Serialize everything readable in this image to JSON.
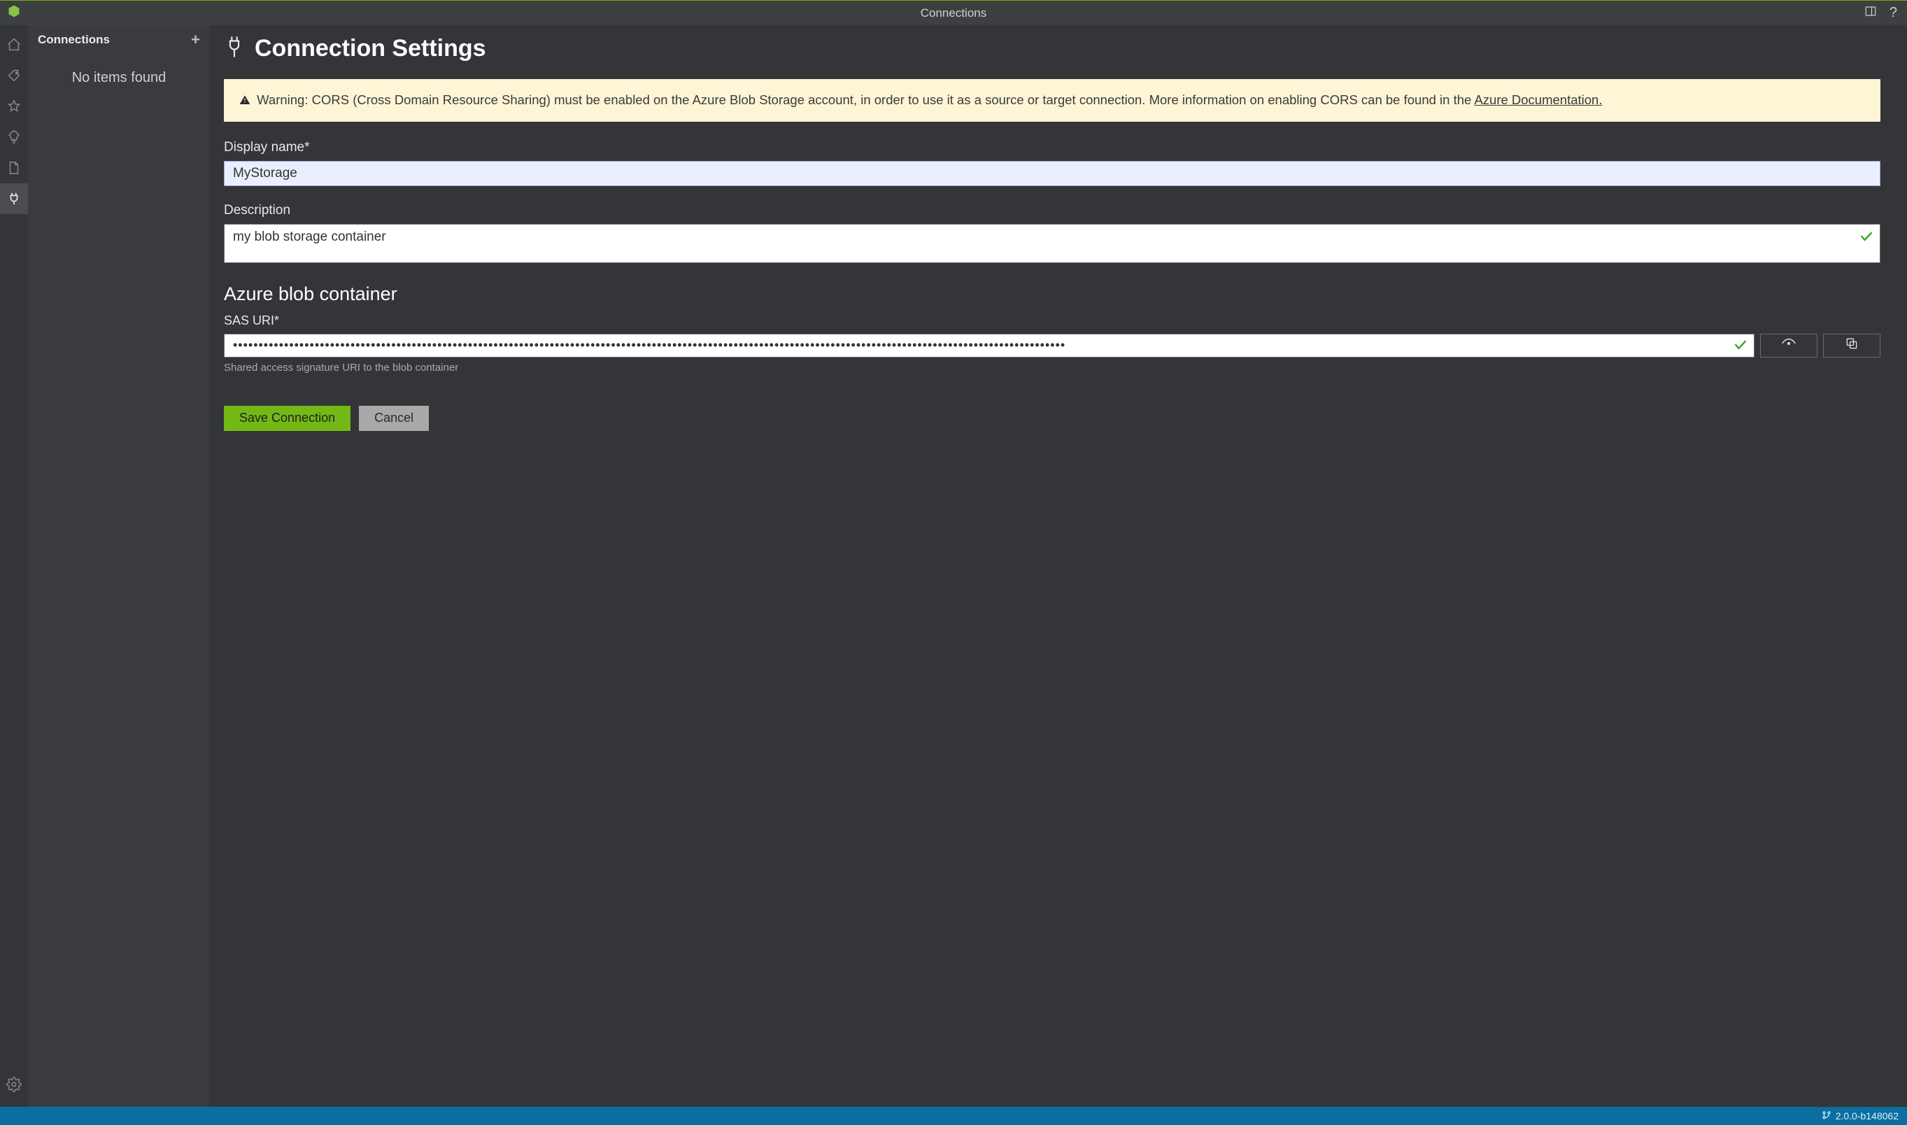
{
  "titlebar": {
    "title": "Connections"
  },
  "sidebar": {
    "title": "Connections",
    "empty_message": "No items found"
  },
  "main": {
    "title": "Connection Settings",
    "warning": {
      "prefix": "Warning: CORS (Cross Domain Resource Sharing) must be enabled on the Azure Blob Storage account, in order to use it as a source or target connection. More information on enabling CORS can be found in the ",
      "link": "Azure Documentation."
    },
    "display_name": {
      "label": "Display name*",
      "value": "MyStorage"
    },
    "description": {
      "label": "Description",
      "value": "my blob storage container"
    },
    "provider_section": {
      "title": "Azure blob container"
    },
    "sas": {
      "label": "SAS URI*",
      "masked_value": "•••••••••••••••••••••••••••••••••••••••••••••••••••••••••••••••••••••••••••••••••••••••••••••••••••••••••••••••••••••••••••••••••••••••••••••••••••••••••••••••••••",
      "hint": "Shared access signature URI to the blob container"
    },
    "actions": {
      "save": "Save Connection",
      "cancel": "Cancel"
    }
  },
  "statusbar": {
    "version": "2.0.0-b148062"
  },
  "colors": {
    "accent_green": "#74b816",
    "warning_bg": "#fdf5d6",
    "statusbar_bg": "#0a6ea0",
    "valid_check": "#3fa62f"
  }
}
